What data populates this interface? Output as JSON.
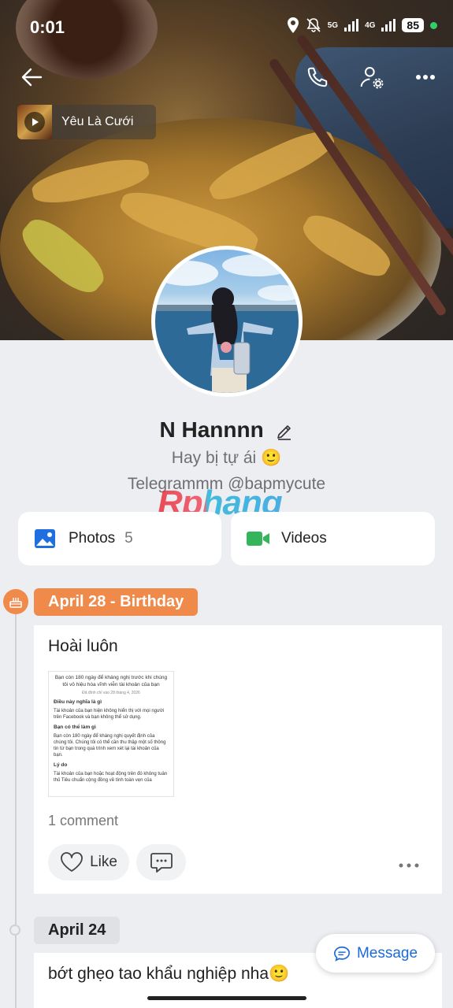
{
  "status_bar": {
    "time": "0:01",
    "network_5g": "5G",
    "network_4g": "4G",
    "battery": "85"
  },
  "header": {
    "back_icon": "arrow-left-icon",
    "call_icon": "phone-icon",
    "settings_icon": "user-settings-icon",
    "more_icon": "more-horizontal-icon"
  },
  "music": {
    "title": "Yêu Là Cưới"
  },
  "profile": {
    "name": "N Hannnn",
    "bio_line1": "Hay bị tự ái 🙂",
    "bio_line2": "Telegrammm @bapmycute"
  },
  "watermark": "Rphang",
  "media_tiles": [
    {
      "label": "Photos",
      "count": "5",
      "icon": "photos-icon",
      "color": "#1f6fe0"
    },
    {
      "label": "Videos",
      "count": "",
      "icon": "video-camera-icon",
      "color": "#35b55b"
    }
  ],
  "timeline": [
    {
      "date_label": "April 28 - Birthday",
      "highlight_color": "#f08a4b",
      "post_text": "Hoài luôn",
      "attachment": {
        "heading": "Bạn còn 180 ngày để kháng nghị trước khi chúng tôi vô hiệu hóa vĩnh viễn tài khoản của bạn",
        "sub": "Đã đình chỉ vào 28 tháng 4, 2026",
        "sections": [
          {
            "title": "Điều này nghĩa là gì",
            "body": "Tài khoản của bạn hiện không hiển thị với mọi người trên Facebook và bạn không thể sử dụng."
          },
          {
            "title": "Bạn có thể làm gì",
            "body": "Bạn còn 180 ngày để kháng nghị quyết định của chúng tôi. Chúng tôi có thể cần thu thập một số thông tin từ bạn trong quá trình xem xét lại tài khoản của bạn."
          },
          {
            "title": "Lý do",
            "body": "Tài khoản của bạn hoặc hoạt động trên đó không tuân thủ Tiêu chuẩn cộng đồng về tính toàn vẹn của"
          }
        ]
      },
      "comment_count": "1 comment",
      "like_label": "Like"
    },
    {
      "date_label": "April 24",
      "post_text": "bớt ghẹo tao khẩu nghiệp nha🙂"
    }
  ],
  "message_button": {
    "label": "Message"
  }
}
